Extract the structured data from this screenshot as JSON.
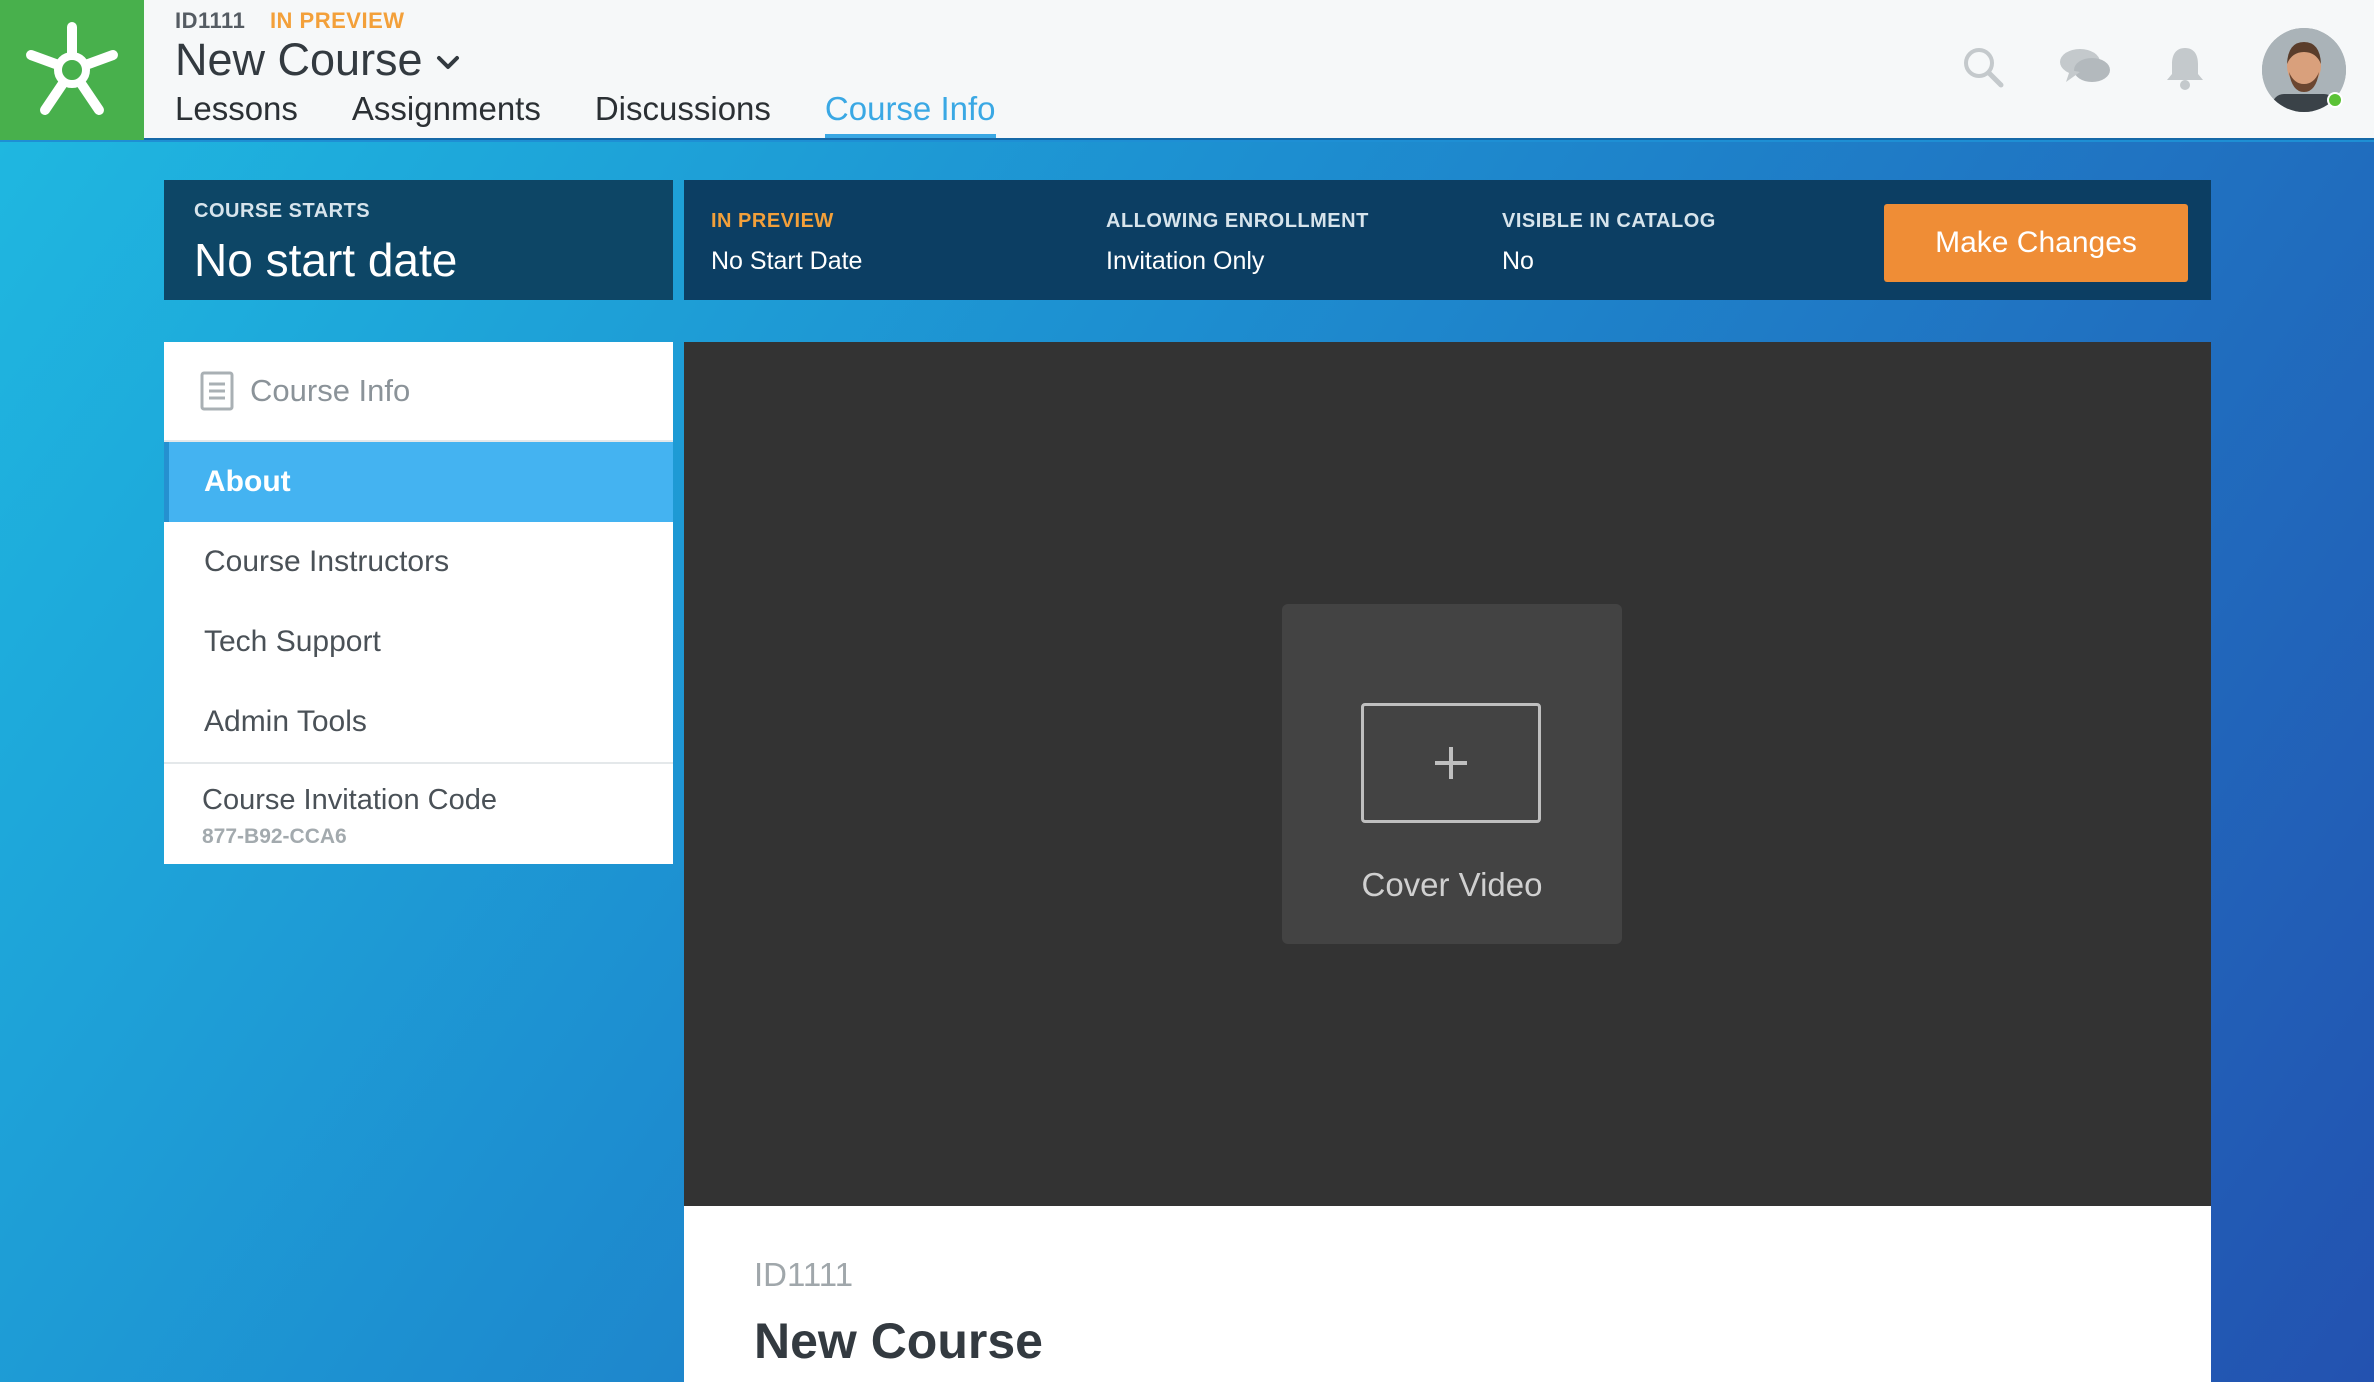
{
  "header": {
    "course_id": "ID1111",
    "course_status": "IN PREVIEW",
    "course_title": "New Course",
    "tabs": [
      {
        "label": "Lessons"
      },
      {
        "label": "Assignments"
      },
      {
        "label": "Discussions"
      },
      {
        "label": "Course Info",
        "active": true
      }
    ],
    "icons": [
      "search-icon",
      "chat-icon",
      "bell-icon",
      "user-avatar"
    ]
  },
  "course_starts": {
    "label": "COURSE STARTS",
    "value": "No start date"
  },
  "status_bar": {
    "preview": {
      "label": "IN PREVIEW",
      "value": "No Start Date"
    },
    "enrollment": {
      "label": "ALLOWING ENROLLMENT",
      "value": "Invitation Only"
    },
    "catalog": {
      "label": "VISIBLE IN CATALOG",
      "value": "No"
    },
    "button_label": "Make Changes"
  },
  "sidebar": {
    "header": "Course Info",
    "items": [
      {
        "label": "About",
        "active": true
      },
      {
        "label": "Course Instructors"
      },
      {
        "label": "Tech Support"
      },
      {
        "label": "Admin Tools"
      }
    ],
    "invitation": {
      "label": "Course Invitation Code",
      "code": "877-B92-CCA6"
    }
  },
  "cover": {
    "label": "Cover Video"
  },
  "info": {
    "course_id": "ID1111",
    "course_title": "New Course"
  },
  "colors": {
    "brand_green": "#48b04c",
    "accent_blue": "#3aa8e4",
    "status_orange": "#f3a03a",
    "button_orange": "#ef8d36"
  }
}
